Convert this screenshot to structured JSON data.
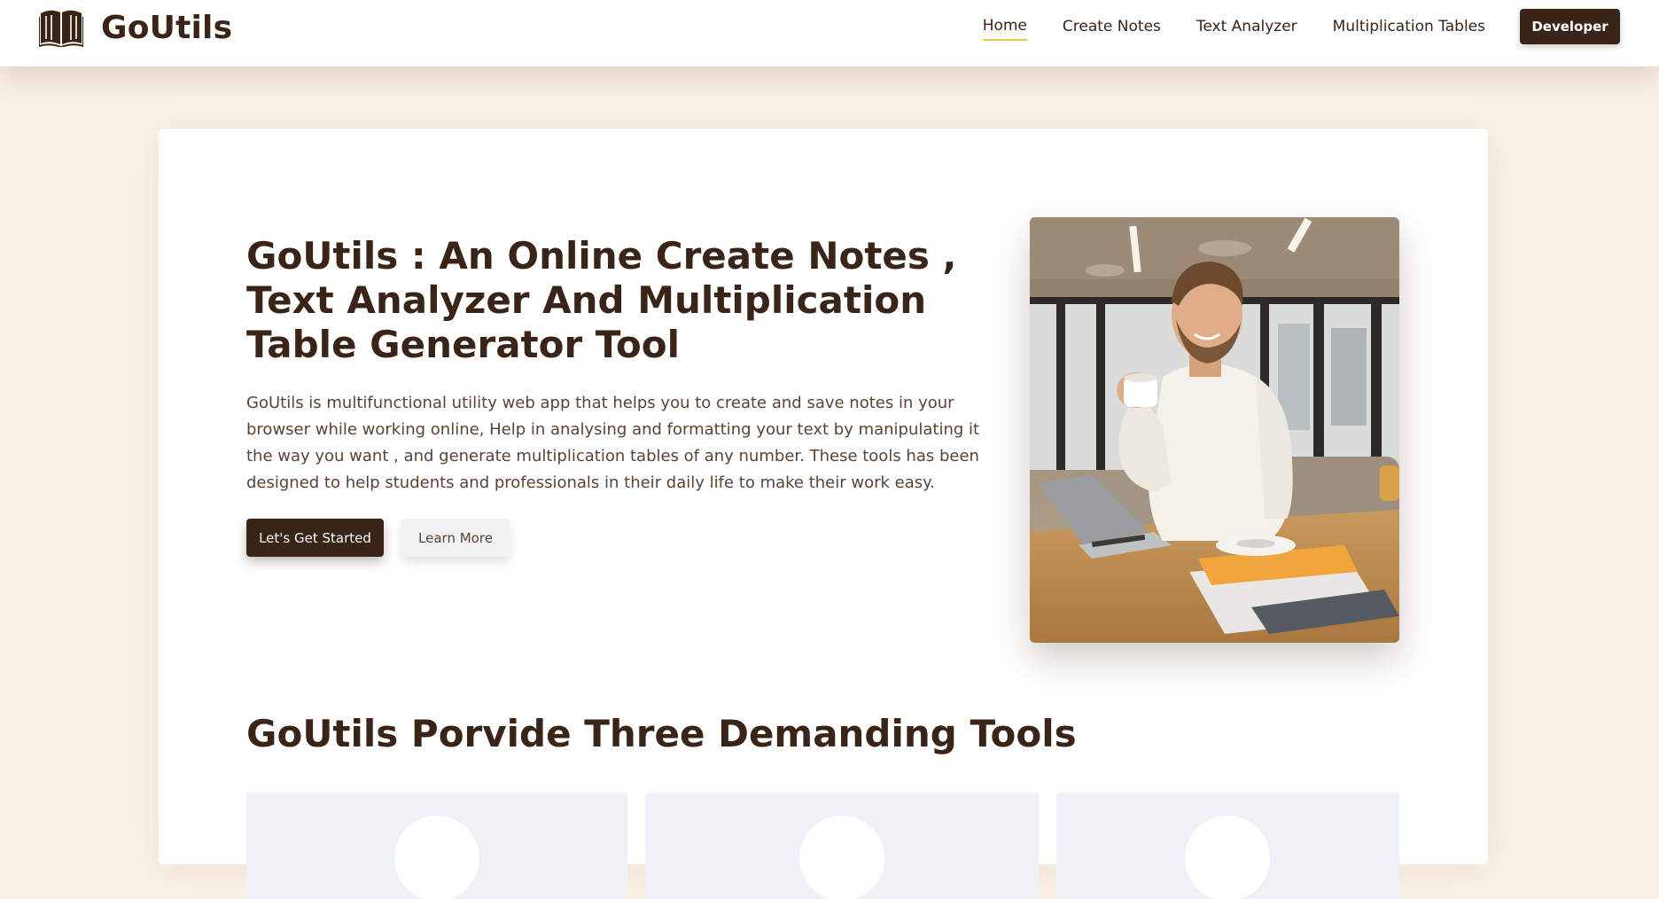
{
  "brand": {
    "name": "GoUtils",
    "icon": "open-book-icon"
  },
  "nav": {
    "links": [
      {
        "label": "Home",
        "active": true
      },
      {
        "label": "Create Notes",
        "active": false
      },
      {
        "label": "Text Analyzer",
        "active": false
      },
      {
        "label": "Multiplication Tables",
        "active": false
      }
    ],
    "developer_button": "Developer"
  },
  "hero": {
    "title": "GoUtils : An Online Create Notes , Text Analyzer And Multiplication Table Generator Tool",
    "description": "GoUtils is multifunctional utility web app that helps you to create and save notes in your browser while working online, Help in analysing and formatting your text by manipulating it the way you want , and generate multiplication tables of any number. These tools has been designed to help students and professionals in their daily life to make their work easy.",
    "primary_button": "Let's Get Started",
    "secondary_button": "Learn More"
  },
  "tools_section": {
    "title": "GoUtils Porvide Three Demanding Tools"
  },
  "colors": {
    "brand_dark": "#3a2418",
    "page_bg": "#faf0e6",
    "active_underline": "#e8c84a",
    "card_bg": "#eef2f7"
  }
}
